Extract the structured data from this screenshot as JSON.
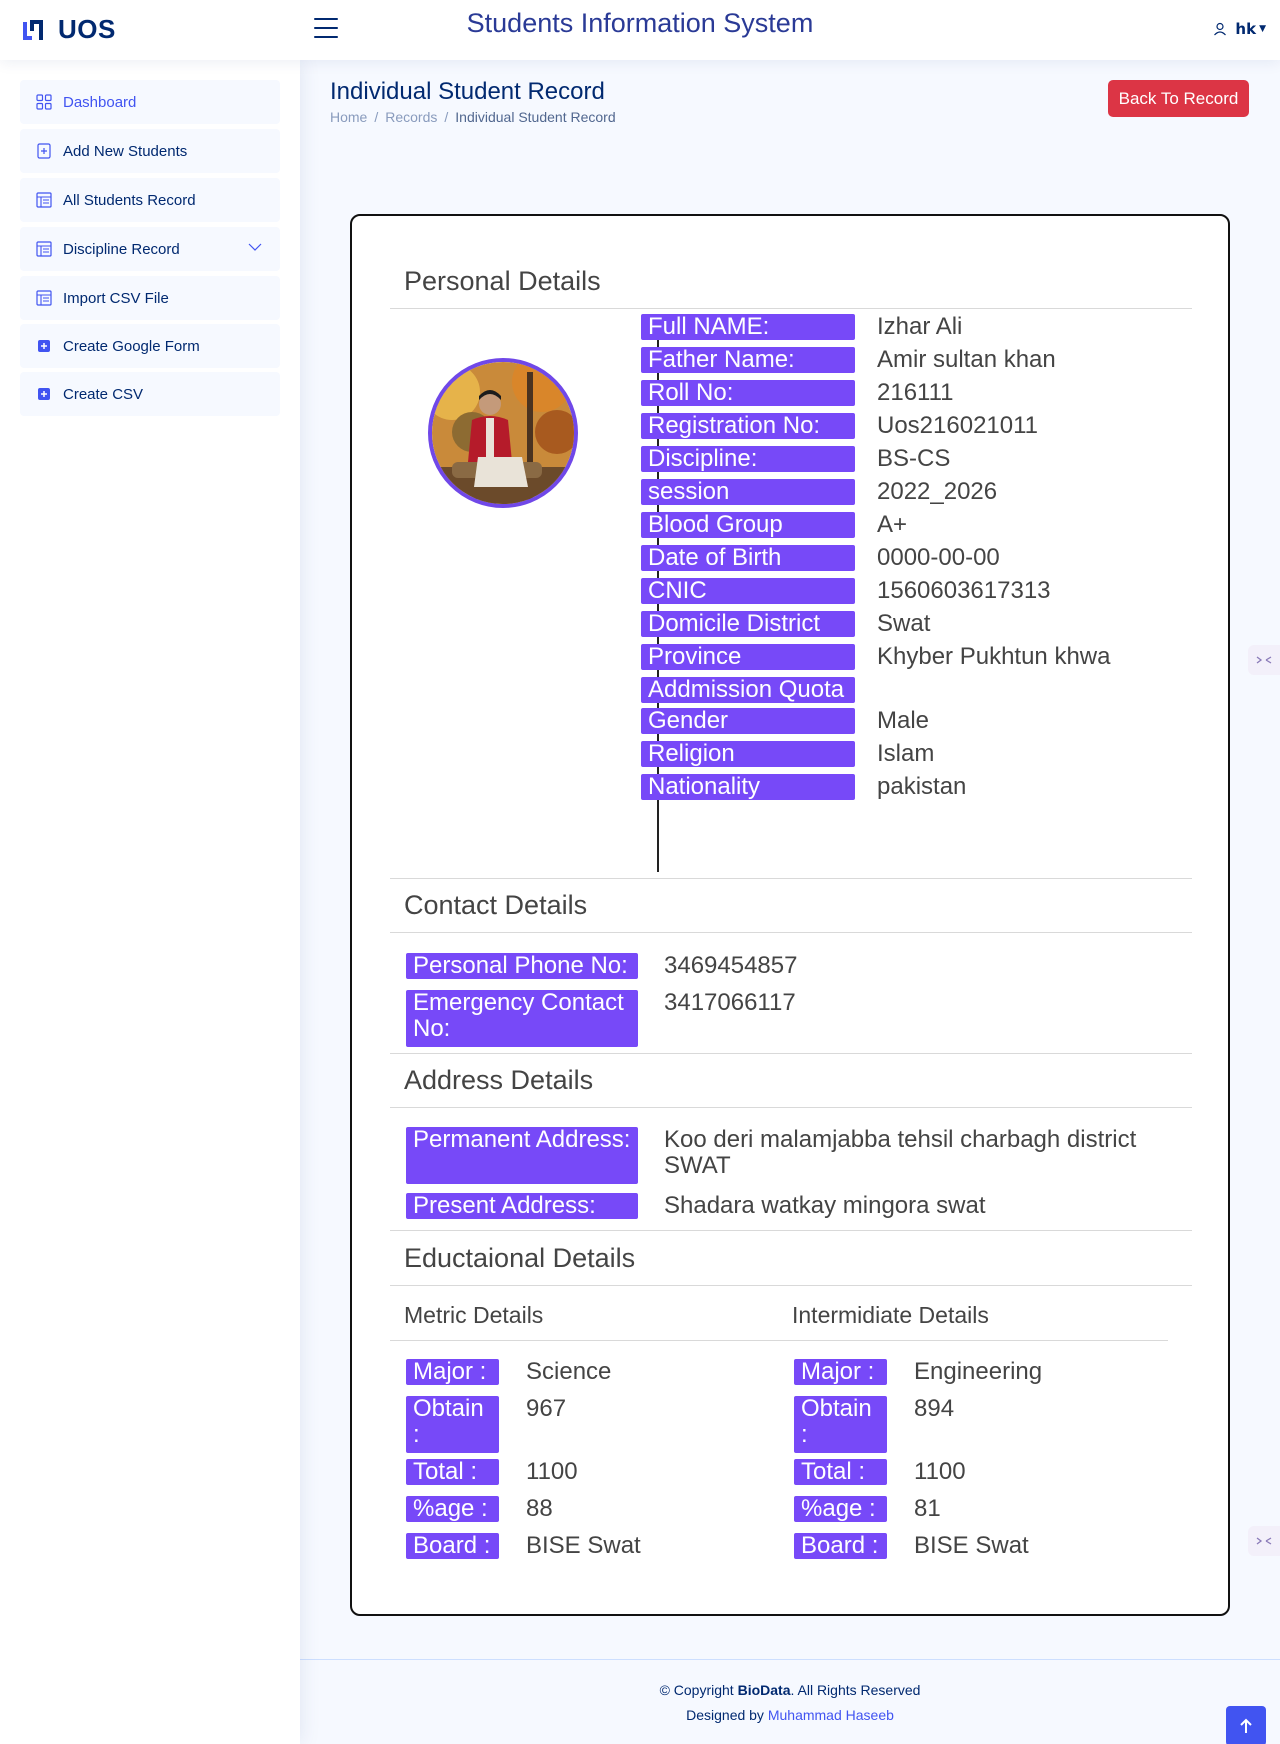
{
  "header": {
    "logo_text": "UOS",
    "app_title": "Students Information System",
    "user_name": "hk"
  },
  "sidebar": {
    "items": [
      {
        "label": "Dashboard",
        "icon": "grid-icon"
      },
      {
        "label": "Add New Students",
        "icon": "document-plus-icon"
      },
      {
        "label": "All Students Record",
        "icon": "layout-text-icon"
      },
      {
        "label": "Discipline Record",
        "icon": "layout-text-icon"
      },
      {
        "label": "Import CSV File",
        "icon": "layout-text-icon"
      },
      {
        "label": "Create Google Form",
        "icon": "plus-square-icon"
      },
      {
        "label": "Create CSV",
        "icon": "plus-square-icon"
      }
    ]
  },
  "page": {
    "title": "Individual Student Record",
    "breadcrumb": [
      "Home",
      "Records",
      "Individual Student Record"
    ],
    "back_button": "Back To Record"
  },
  "personal": {
    "title": "Personal Details",
    "fields": [
      {
        "label": "Full NAME:",
        "value": "Izhar Ali"
      },
      {
        "label": "Father Name:",
        "value": "Amir sultan khan"
      },
      {
        "label": "Roll No:",
        "value": "216111"
      },
      {
        "label": "Registration No:",
        "value": "Uos216021011"
      },
      {
        "label": "Discipline:",
        "value": "BS-CS"
      },
      {
        "label": "session",
        "value": "2022_2026"
      },
      {
        "label": "Blood Group",
        "value": "A+"
      },
      {
        "label": "Date of Birth",
        "value": "0000-00-00"
      },
      {
        "label": "CNIC",
        "value": "1560603617313"
      },
      {
        "label": "Domicile District",
        "value": "Swat"
      },
      {
        "label": "Province",
        "value": "Khyber Pukhtun khwa"
      },
      {
        "label": "Addmission Quota",
        "value": ""
      },
      {
        "label": "Gender",
        "value": "Male"
      },
      {
        "label": "Religion",
        "value": "Islam"
      },
      {
        "label": "Nationality",
        "value": "pakistan"
      }
    ]
  },
  "contact": {
    "title": "Contact Details",
    "phone_label": "Personal Phone No:",
    "phone_value": "3469454857",
    "emergency_label": "Emergency Contact No:",
    "emergency_value": "3417066117"
  },
  "address": {
    "title": "Address Details",
    "permanent_label": "Permanent Address:",
    "permanent_value": "Koo deri malamjabba tehsil charbagh district SWAT",
    "present_label": "Present Address:",
    "present_value": "Shadara watkay mingora swat"
  },
  "education": {
    "title": "Eductaional Details",
    "metric": {
      "title": "Metric Details",
      "major_label": "Major :",
      "major": "Science",
      "obtain_label": "Obtain :",
      "obtain": "967",
      "total_label": "Total :",
      "total": "1100",
      "percent_label": "%age :",
      "percent": "88",
      "board_label": "Board :",
      "board": "BISE Swat"
    },
    "inter": {
      "title": "Intermidiate Details",
      "major_label": "Major :",
      "major": "Engineering",
      "obtain_label": "Obtain :",
      "obtain": "894",
      "total_label": "Total :",
      "total": "1100",
      "percent_label": "%age :",
      "percent": "81",
      "board_label": "Board :",
      "board": "BISE Swat"
    }
  },
  "footer": {
    "copyright_prefix": "© Copyright ",
    "brand": "BioData",
    "copyright_suffix": ". All Rights Reserved",
    "designed_prefix": "Designed by ",
    "designer": "Muhammad Haseeb"
  },
  "colors": {
    "label_bg": "#7749f8",
    "primary": "#4154f1",
    "navy": "#012970",
    "danger": "#dc3545"
  }
}
